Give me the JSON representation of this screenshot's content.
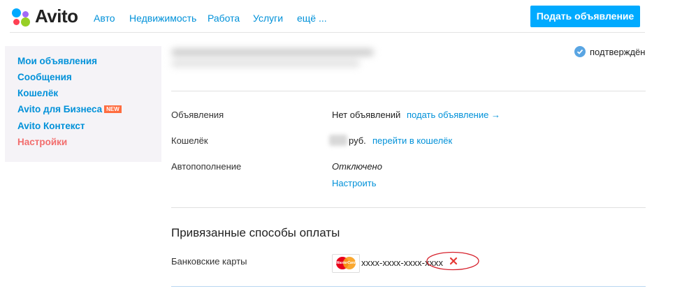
{
  "header": {
    "logo_text": "Avito",
    "nav": [
      "Авто",
      "Недвижимость",
      "Работа",
      "Услуги",
      "ещё ..."
    ],
    "post_button": "Подать объявление"
  },
  "sidebar": {
    "items": [
      {
        "label": "Мои объявления"
      },
      {
        "label": "Сообщения"
      },
      {
        "label": "Кошелёк"
      },
      {
        "label": "Avito для Бизнеса",
        "badge": "NEW"
      },
      {
        "label": "Avito Контекст"
      },
      {
        "label": "Настройки",
        "active": true
      }
    ]
  },
  "profile": {
    "confirmed_label": "подтверждён"
  },
  "rows": {
    "ads": {
      "label": "Объявления",
      "value": "Нет объявлений",
      "link": "подать объявление →"
    },
    "wallet": {
      "label": "Кошелёк",
      "currency": "руб.",
      "link": "перейти в кошелёк"
    },
    "autotopup": {
      "label": "Автопополнение",
      "value": "Отключено",
      "link": "Настроить"
    }
  },
  "payments": {
    "title": "Привязанные способы оплаты",
    "cards_label": "Банковские карты",
    "card_brand": "MasterCard",
    "card_number": "xxxx-xxxx-xxxx-xxxx",
    "remove_glyph": "×"
  },
  "colors": {
    "accent": "#00aaff",
    "link": "#0091d9",
    "active": "#f26d6d",
    "sidebar_bg": "#f5f3f7"
  }
}
